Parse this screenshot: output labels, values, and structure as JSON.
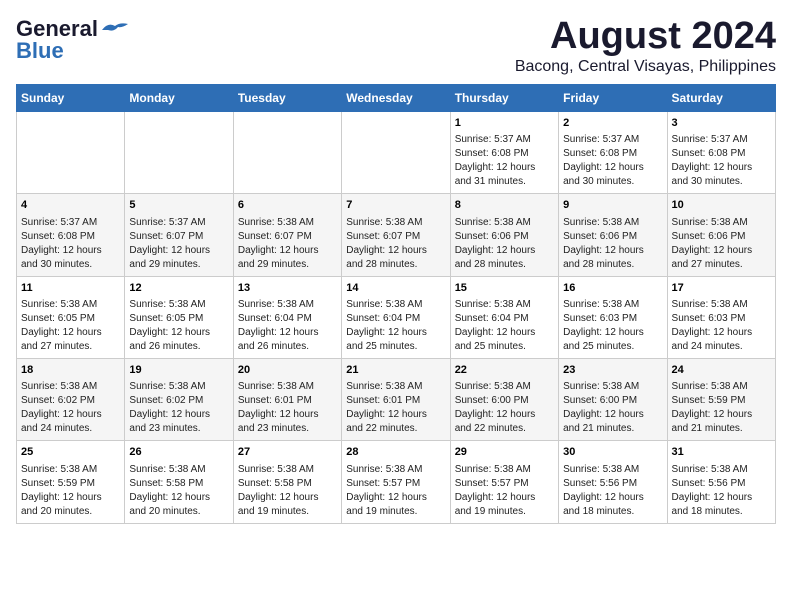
{
  "logo": {
    "general": "General",
    "blue": "Blue"
  },
  "title": "August 2024",
  "subtitle": "Bacong, Central Visayas, Philippines",
  "days_of_week": [
    "Sunday",
    "Monday",
    "Tuesday",
    "Wednesday",
    "Thursday",
    "Friday",
    "Saturday"
  ],
  "weeks": [
    [
      {
        "day": "",
        "content": ""
      },
      {
        "day": "",
        "content": ""
      },
      {
        "day": "",
        "content": ""
      },
      {
        "day": "",
        "content": ""
      },
      {
        "day": "1",
        "content": "Sunrise: 5:37 AM\nSunset: 6:08 PM\nDaylight: 12 hours\nand 31 minutes."
      },
      {
        "day": "2",
        "content": "Sunrise: 5:37 AM\nSunset: 6:08 PM\nDaylight: 12 hours\nand 30 minutes."
      },
      {
        "day": "3",
        "content": "Sunrise: 5:37 AM\nSunset: 6:08 PM\nDaylight: 12 hours\nand 30 minutes."
      }
    ],
    [
      {
        "day": "4",
        "content": "Sunrise: 5:37 AM\nSunset: 6:08 PM\nDaylight: 12 hours\nand 30 minutes."
      },
      {
        "day": "5",
        "content": "Sunrise: 5:37 AM\nSunset: 6:07 PM\nDaylight: 12 hours\nand 29 minutes."
      },
      {
        "day": "6",
        "content": "Sunrise: 5:38 AM\nSunset: 6:07 PM\nDaylight: 12 hours\nand 29 minutes."
      },
      {
        "day": "7",
        "content": "Sunrise: 5:38 AM\nSunset: 6:07 PM\nDaylight: 12 hours\nand 28 minutes."
      },
      {
        "day": "8",
        "content": "Sunrise: 5:38 AM\nSunset: 6:06 PM\nDaylight: 12 hours\nand 28 minutes."
      },
      {
        "day": "9",
        "content": "Sunrise: 5:38 AM\nSunset: 6:06 PM\nDaylight: 12 hours\nand 28 minutes."
      },
      {
        "day": "10",
        "content": "Sunrise: 5:38 AM\nSunset: 6:06 PM\nDaylight: 12 hours\nand 27 minutes."
      }
    ],
    [
      {
        "day": "11",
        "content": "Sunrise: 5:38 AM\nSunset: 6:05 PM\nDaylight: 12 hours\nand 27 minutes."
      },
      {
        "day": "12",
        "content": "Sunrise: 5:38 AM\nSunset: 6:05 PM\nDaylight: 12 hours\nand 26 minutes."
      },
      {
        "day": "13",
        "content": "Sunrise: 5:38 AM\nSunset: 6:04 PM\nDaylight: 12 hours\nand 26 minutes."
      },
      {
        "day": "14",
        "content": "Sunrise: 5:38 AM\nSunset: 6:04 PM\nDaylight: 12 hours\nand 25 minutes."
      },
      {
        "day": "15",
        "content": "Sunrise: 5:38 AM\nSunset: 6:04 PM\nDaylight: 12 hours\nand 25 minutes."
      },
      {
        "day": "16",
        "content": "Sunrise: 5:38 AM\nSunset: 6:03 PM\nDaylight: 12 hours\nand 25 minutes."
      },
      {
        "day": "17",
        "content": "Sunrise: 5:38 AM\nSunset: 6:03 PM\nDaylight: 12 hours\nand 24 minutes."
      }
    ],
    [
      {
        "day": "18",
        "content": "Sunrise: 5:38 AM\nSunset: 6:02 PM\nDaylight: 12 hours\nand 24 minutes."
      },
      {
        "day": "19",
        "content": "Sunrise: 5:38 AM\nSunset: 6:02 PM\nDaylight: 12 hours\nand 23 minutes."
      },
      {
        "day": "20",
        "content": "Sunrise: 5:38 AM\nSunset: 6:01 PM\nDaylight: 12 hours\nand 23 minutes."
      },
      {
        "day": "21",
        "content": "Sunrise: 5:38 AM\nSunset: 6:01 PM\nDaylight: 12 hours\nand 22 minutes."
      },
      {
        "day": "22",
        "content": "Sunrise: 5:38 AM\nSunset: 6:00 PM\nDaylight: 12 hours\nand 22 minutes."
      },
      {
        "day": "23",
        "content": "Sunrise: 5:38 AM\nSunset: 6:00 PM\nDaylight: 12 hours\nand 21 minutes."
      },
      {
        "day": "24",
        "content": "Sunrise: 5:38 AM\nSunset: 5:59 PM\nDaylight: 12 hours\nand 21 minutes."
      }
    ],
    [
      {
        "day": "25",
        "content": "Sunrise: 5:38 AM\nSunset: 5:59 PM\nDaylight: 12 hours\nand 20 minutes."
      },
      {
        "day": "26",
        "content": "Sunrise: 5:38 AM\nSunset: 5:58 PM\nDaylight: 12 hours\nand 20 minutes."
      },
      {
        "day": "27",
        "content": "Sunrise: 5:38 AM\nSunset: 5:58 PM\nDaylight: 12 hours\nand 19 minutes."
      },
      {
        "day": "28",
        "content": "Sunrise: 5:38 AM\nSunset: 5:57 PM\nDaylight: 12 hours\nand 19 minutes."
      },
      {
        "day": "29",
        "content": "Sunrise: 5:38 AM\nSunset: 5:57 PM\nDaylight: 12 hours\nand 19 minutes."
      },
      {
        "day": "30",
        "content": "Sunrise: 5:38 AM\nSunset: 5:56 PM\nDaylight: 12 hours\nand 18 minutes."
      },
      {
        "day": "31",
        "content": "Sunrise: 5:38 AM\nSunset: 5:56 PM\nDaylight: 12 hours\nand 18 minutes."
      }
    ]
  ]
}
